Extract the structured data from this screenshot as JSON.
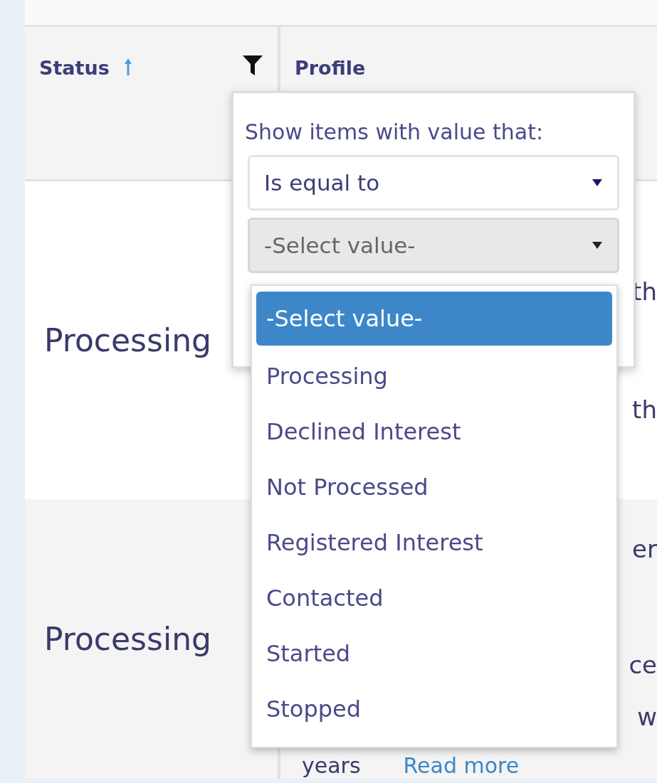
{
  "table": {
    "columns": [
      {
        "label": "Status",
        "sorted_ascending": true,
        "filterable": true
      },
      {
        "label": "Profile"
      }
    ],
    "rows": [
      {
        "status": "Processing",
        "profile_fragments": [
          "th",
          "th"
        ]
      },
      {
        "status": "Processing",
        "profile_fragments": [
          "er",
          "ce",
          "w"
        ],
        "profile_text": "years",
        "profile_link": "Read more"
      }
    ]
  },
  "filter_menu": {
    "prompt": "Show items with value that:",
    "operator": "Is equal to",
    "value": "-Select value-",
    "expanded": true,
    "options": [
      {
        "label": "-Select value-",
        "selected": true
      },
      {
        "label": "Processing",
        "selected": false
      },
      {
        "label": "Declined Interest",
        "selected": false
      },
      {
        "label": "Not Processed",
        "selected": false
      },
      {
        "label": "Registered Interest",
        "selected": false
      },
      {
        "label": "Contacted",
        "selected": false
      },
      {
        "label": "Started",
        "selected": false
      },
      {
        "label": "Stopped",
        "selected": false
      }
    ]
  }
}
